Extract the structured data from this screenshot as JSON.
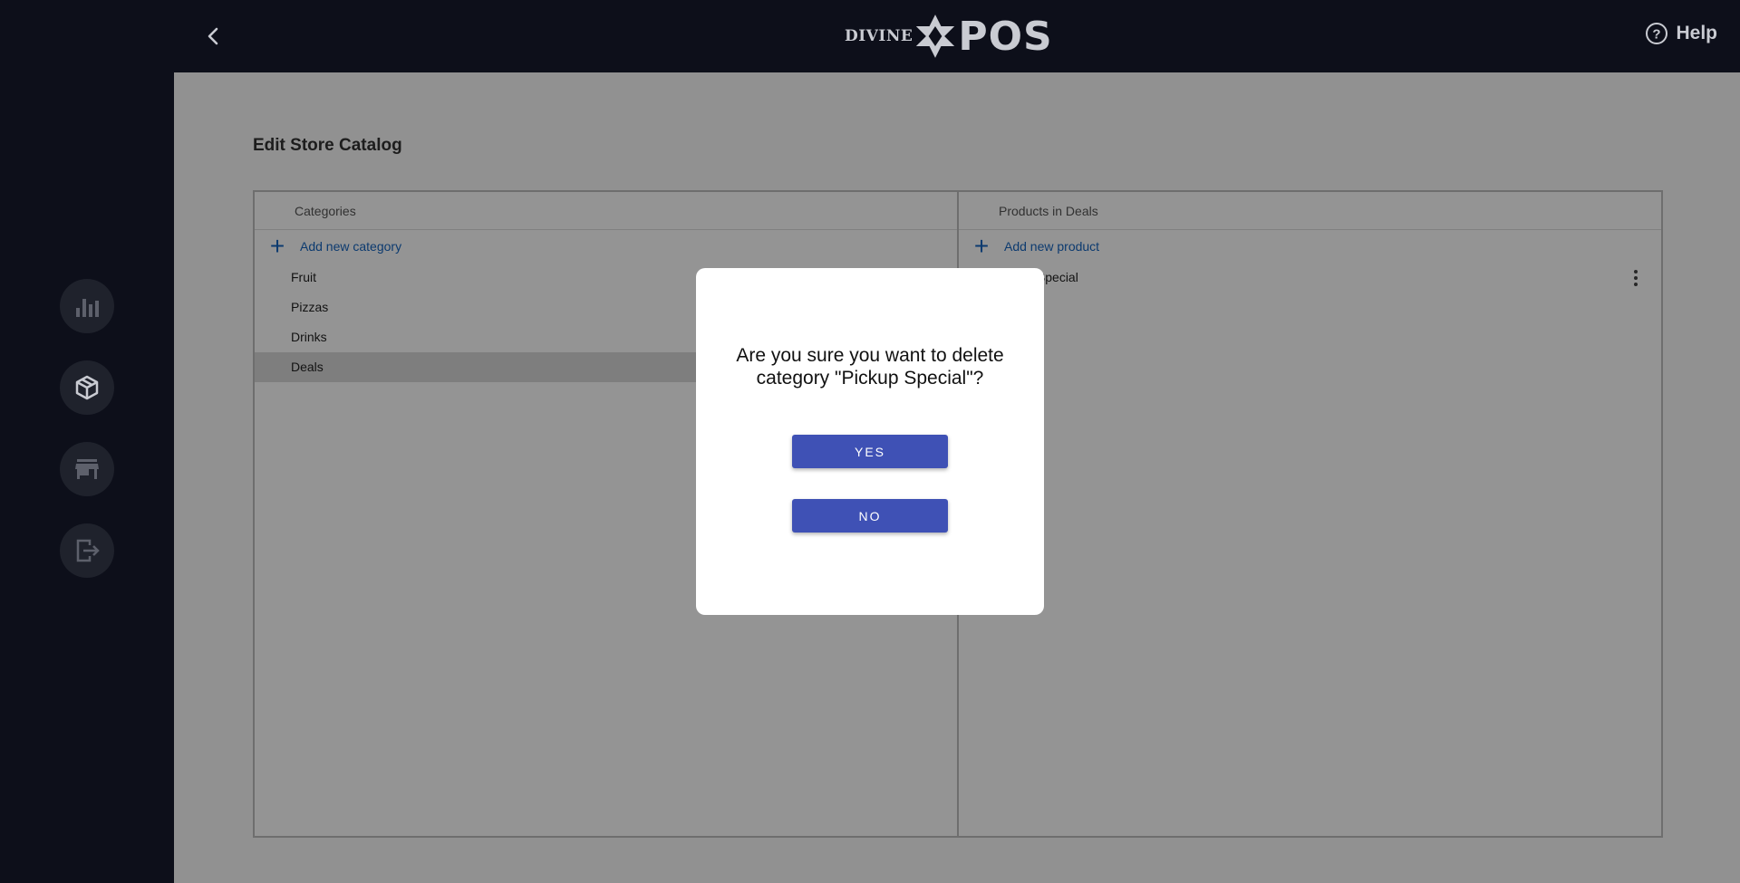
{
  "header": {
    "logo_small": "DIVINE",
    "logo_big": "POS",
    "help_label": "Help"
  },
  "sidebar": {
    "items": [
      {
        "icon": "bar-chart-icon"
      },
      {
        "icon": "package-icon"
      },
      {
        "icon": "store-icon"
      },
      {
        "icon": "logout-icon"
      }
    ]
  },
  "page": {
    "title": "Edit Store Catalog"
  },
  "categories": {
    "header": "Categories",
    "add_label": "Add new category",
    "items": [
      "Fruit",
      "Pizzas",
      "Drinks",
      "Deals"
    ],
    "selected": "Deals"
  },
  "products": {
    "header": "Products in Deals",
    "add_label": "Add new product",
    "items": [
      "Pickup Special"
    ]
  },
  "dialog": {
    "message": "Are you sure you want to delete category \"Pickup Special\"?",
    "yes_label": "YES",
    "no_label": "NO"
  },
  "colors": {
    "sidebar_bg": "#0d0f1a",
    "accent": "#3f51b5",
    "link": "#1565c0"
  }
}
